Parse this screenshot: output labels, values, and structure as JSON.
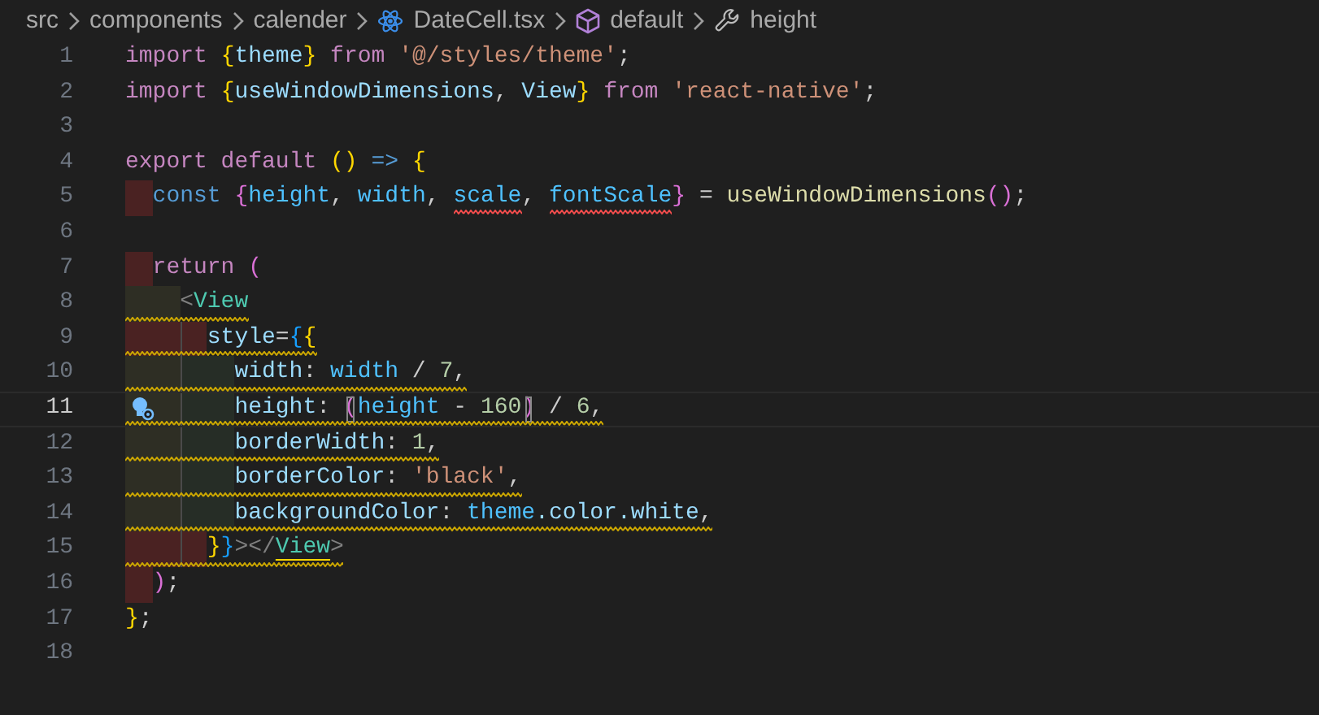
{
  "breadcrumb": [
    {
      "text": "src",
      "kind": "folder"
    },
    {
      "text": "components",
      "kind": "folder"
    },
    {
      "text": "calender",
      "kind": "folder"
    },
    {
      "text": "DateCell.tsx",
      "kind": "file"
    },
    {
      "text": "default",
      "kind": "module"
    },
    {
      "text": "height",
      "kind": "property"
    }
  ],
  "lines": [
    {
      "number": "1",
      "current": false,
      "tokens": [
        {
          "text": "import ",
          "kind": "keyword"
        },
        {
          "text": "{",
          "kind": "brace"
        },
        {
          "text": "theme",
          "kind": "variable"
        },
        {
          "text": "}",
          "kind": "brace"
        },
        {
          "text": " from ",
          "kind": "keyword"
        },
        {
          "text": "'@/styles/theme'",
          "kind": "string"
        },
        {
          "text": ";",
          "kind": "punct"
        }
      ]
    },
    {
      "number": "2",
      "current": false,
      "tokens": [
        {
          "text": "import ",
          "kind": "keyword"
        },
        {
          "text": "{",
          "kind": "brace"
        },
        {
          "text": "useWindowDimensions",
          "kind": "variable"
        },
        {
          "text": ", ",
          "kind": "punct"
        },
        {
          "text": "View",
          "kind": "variable"
        },
        {
          "text": "}",
          "kind": "brace"
        },
        {
          "text": " from ",
          "kind": "keyword"
        },
        {
          "text": "'react-native'",
          "kind": "string"
        },
        {
          "text": ";",
          "kind": "punct"
        }
      ]
    },
    {
      "number": "3",
      "current": false
    },
    {
      "number": "4",
      "current": false,
      "tokens": [
        {
          "text": "export default ",
          "kind": "keyword"
        },
        {
          "text": "() ",
          "kind": "brace"
        },
        {
          "text": "=> ",
          "kind": "storage"
        },
        {
          "text": "{",
          "kind": "brace"
        }
      ]
    },
    {
      "number": "5",
      "current": false,
      "indent": [
        {
          "error": true
        }
      ],
      "tokens": [
        {
          "text": "const ",
          "kind": "storage"
        },
        {
          "text": "{",
          "kind": "paren"
        },
        {
          "text": "height",
          "kind": "constant"
        },
        {
          "text": ", ",
          "kind": "punct"
        },
        {
          "text": "width",
          "kind": "constant"
        },
        {
          "text": ", ",
          "kind": "punct"
        },
        {
          "text": "scale",
          "kind": "constant",
          "error": true
        },
        {
          "text": ", ",
          "kind": "punct"
        },
        {
          "text": "fontScale",
          "kind": "constant",
          "error": true
        },
        {
          "text": "}",
          "kind": "paren"
        },
        {
          "text": " = ",
          "kind": "punct"
        },
        {
          "text": "useWindowDimensions",
          "kind": "func"
        },
        {
          "text": "()",
          "kind": "paren"
        },
        {
          "text": ";",
          "kind": "punct"
        }
      ]
    },
    {
      "number": "6",
      "current": false
    },
    {
      "number": "7",
      "current": false,
      "indent": [
        {
          "error": true
        }
      ],
      "tokens": [
        {
          "text": "return ",
          "kind": "keyword"
        },
        {
          "text": "(",
          "kind": "paren"
        }
      ]
    },
    {
      "number": "8",
      "current": false,
      "warning": true,
      "indent": [
        {
          "error": false
        }
      ],
      "tokens": [
        {
          "text": "<",
          "kind": "tagpunct"
        },
        {
          "text": "View",
          "kind": "tag"
        }
      ]
    },
    {
      "number": "9",
      "current": false,
      "warning": true,
      "indent": [
        {
          "error": true
        },
        {
          "error": true
        }
      ],
      "tokens": [
        {
          "text": "style",
          "kind": "variable"
        },
        {
          "text": "=",
          "kind": "punct"
        },
        {
          "text": "{",
          "kind": "bracket"
        },
        {
          "text": "{",
          "kind": "brace"
        }
      ]
    },
    {
      "number": "10",
      "current": false,
      "warning": true,
      "indent": [
        {
          "error": false
        },
        {
          "error": false
        }
      ],
      "tokens": [
        {
          "text": "width",
          "kind": "variable"
        },
        {
          "text": ": ",
          "kind": "punct"
        },
        {
          "text": "width",
          "kind": "constant"
        },
        {
          "text": " / ",
          "kind": "punct"
        },
        {
          "text": "7",
          "kind": "number"
        },
        {
          "text": ",",
          "kind": "punct"
        }
      ]
    },
    {
      "number": "11",
      "current": true,
      "warning": true,
      "lightbulb": true,
      "indent": [
        {
          "error": false
        },
        {
          "error": false
        }
      ],
      "tokens": [
        {
          "text": "height",
          "kind": "variable"
        },
        {
          "text": ": ",
          "kind": "punct"
        },
        {
          "text": "(",
          "kind": "paren",
          "matched": true
        },
        {
          "text": "height",
          "kind": "constant"
        },
        {
          "text": " - ",
          "kind": "punct"
        },
        {
          "text": "160",
          "kind": "number"
        },
        {
          "text": ")",
          "kind": "paren",
          "matched": true
        },
        {
          "text": " / ",
          "kind": "punct"
        },
        {
          "text": "6",
          "kind": "number"
        },
        {
          "text": ",",
          "kind": "punct"
        }
      ]
    },
    {
      "number": "12",
      "current": false,
      "warning": true,
      "indent": [
        {
          "error": false
        },
        {
          "error": false
        }
      ],
      "tokens": [
        {
          "text": "borderWidth",
          "kind": "variable"
        },
        {
          "text": ": ",
          "kind": "punct"
        },
        {
          "text": "1",
          "kind": "number"
        },
        {
          "text": ",",
          "kind": "punct"
        }
      ]
    },
    {
      "number": "13",
      "current": false,
      "warning": true,
      "indent": [
        {
          "error": false
        },
        {
          "error": false
        }
      ],
      "tokens": [
        {
          "text": "borderColor",
          "kind": "variable"
        },
        {
          "text": ": ",
          "kind": "punct"
        },
        {
          "text": "'black'",
          "kind": "string"
        },
        {
          "text": ",",
          "kind": "punct"
        }
      ]
    },
    {
      "number": "14",
      "current": false,
      "warning": true,
      "indent": [
        {
          "error": false
        },
        {
          "error": false
        }
      ],
      "tokens": [
        {
          "text": "backgroundColor",
          "kind": "variable"
        },
        {
          "text": ": ",
          "kind": "punct"
        },
        {
          "text": "theme",
          "kind": "constant"
        },
        {
          "text": ".color.white",
          "kind": "variable"
        },
        {
          "text": ",",
          "kind": "punct"
        }
      ]
    },
    {
      "number": "15",
      "current": false,
      "warning": true,
      "indent": [
        {
          "error": true
        },
        {
          "error": true
        }
      ],
      "tokens": [
        {
          "text": "}",
          "kind": "brace"
        },
        {
          "text": "}",
          "kind": "bracket"
        },
        {
          "text": "></",
          "kind": "tagpunct"
        },
        {
          "text": "View",
          "kind": "tag",
          "highlighted": true
        },
        {
          "text": ">",
          "kind": "tagpunct"
        }
      ]
    },
    {
      "number": "16",
      "current": false,
      "indent": [
        {
          "error": true
        }
      ],
      "tokens": [
        {
          "text": ")",
          "kind": "paren"
        },
        {
          "text": ";",
          "kind": "punct"
        }
      ]
    },
    {
      "number": "17",
      "current": false,
      "tokens": [
        {
          "text": "}",
          "kind": "brace"
        },
        {
          "text": ";",
          "kind": "punct"
        }
      ]
    },
    {
      "number": "18",
      "current": false
    }
  ]
}
